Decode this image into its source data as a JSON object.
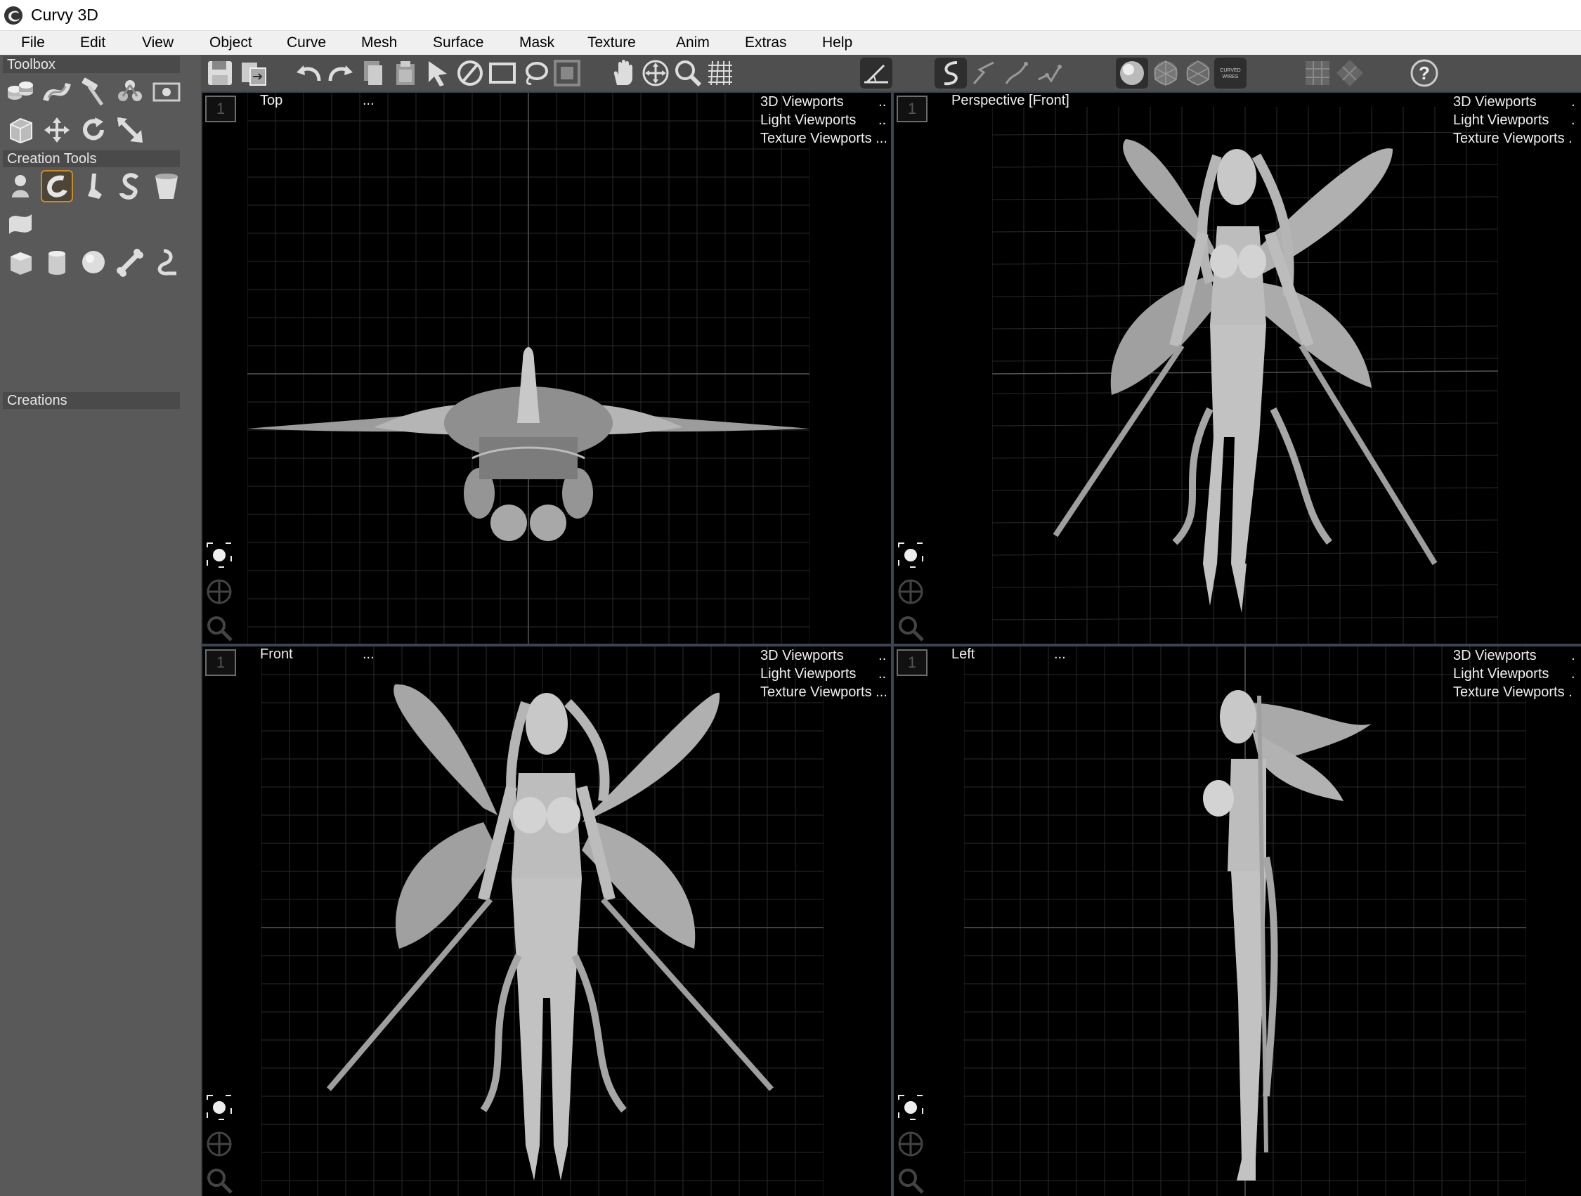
{
  "app": {
    "title": "Curvy 3D"
  },
  "menu": [
    "File",
    "Edit",
    "View",
    "Object",
    "Curve",
    "Mesh",
    "Surface",
    "Mask",
    "Texture",
    "Anim",
    "Extras",
    "Help"
  ],
  "sidebar": {
    "toolbox_label": "Toolbox",
    "creation_tools_label": "Creation Tools",
    "creations_label": "Creations",
    "toolbox_icons": [
      "cylinders-icon",
      "twist-icon",
      "hammer-icon",
      "molecule-icon",
      "frame-icon",
      "box-icon",
      "move-icon",
      "rotate-icon",
      "scale-icon"
    ],
    "creation_icons": [
      "blob-icon",
      "curved-tube-icon",
      "leg-icon",
      "s-curve-icon",
      "cup-icon",
      "surface-icon",
      "cube-icon",
      "cylinder-icon",
      "sphere-icon",
      "bone-icon",
      "hook-icon"
    ]
  },
  "toolbar": {
    "curved_wires_label": "CURVED WIRES",
    "icons": [
      "save-icon",
      "export-icon",
      "undo-icon",
      "redo-icon",
      "copy-icon",
      "paste-icon",
      "select-arrow-icon",
      "deselect-icon",
      "rect-select-icon",
      "lasso-select-icon",
      "mask-select-icon",
      "pan-hand-icon",
      "move-view-icon",
      "zoom-icon",
      "grid-icon",
      "tilt-view-icon",
      "curve-edit-icon",
      "curve-tool-2-icon",
      "curve-tool-3-icon",
      "curve-tool-4-icon",
      "solid-shading-icon",
      "wire-shading-icon",
      "wire-shading-2-icon",
      "curved-wires-icon",
      "layout-grid-icon",
      "layout-diamond-icon",
      "help-icon"
    ]
  },
  "viewports": [
    {
      "number": "1",
      "label": "Top",
      "dots": "...",
      "menu": [
        "3D Viewports",
        "Light Viewports",
        "Texture Viewports"
      ],
      "menu_dots": [
        "..",
        "..",
        "..."
      ]
    },
    {
      "number": "1",
      "label": "Perspective [Front]",
      "dots": "",
      "menu": [
        "3D Viewports",
        "Light Viewports",
        "Texture Viewports"
      ],
      "menu_dots": [
        ".",
        ".",
        "."
      ]
    },
    {
      "number": "1",
      "label": "Front",
      "dots": "...",
      "menu": [
        "3D Viewports",
        "Light Viewports",
        "Texture Viewports"
      ],
      "menu_dots": [
        "..",
        "..",
        "..."
      ]
    },
    {
      "number": "1",
      "label": "Left",
      "dots": "...",
      "menu": [
        "3D Viewports",
        "Light Viewports",
        "Texture Viewports"
      ],
      "menu_dots": [
        ".",
        ".",
        "."
      ]
    }
  ],
  "colors": {
    "sidebar": "#595959",
    "toolbar": "#4f4f4f",
    "viewport_bg": "#000000",
    "selected_tool_border": "#c98a2a",
    "grid": "#2a2a2a"
  }
}
